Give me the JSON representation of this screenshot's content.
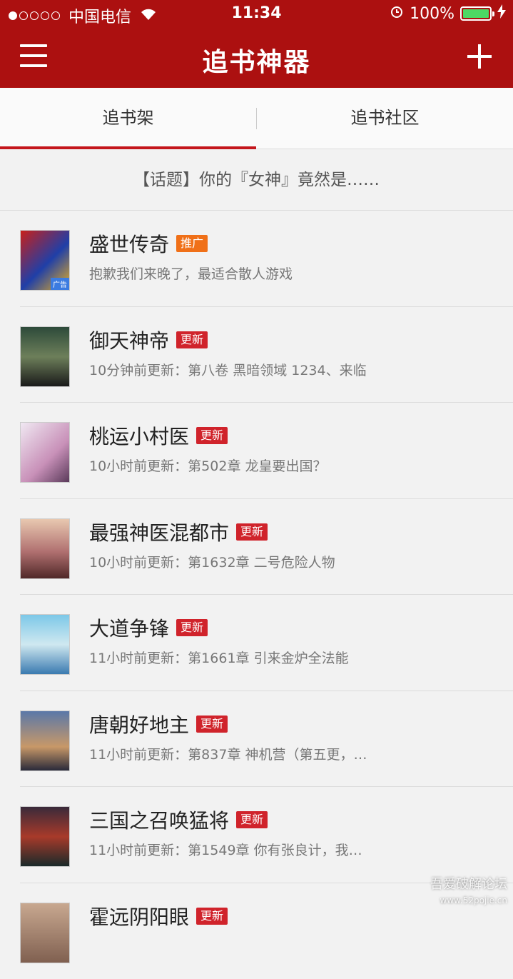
{
  "status_bar": {
    "carrier": "中国电信",
    "time": "11:34",
    "battery": "100%"
  },
  "header": {
    "title": "追书神器"
  },
  "tabs": [
    {
      "label": "追书架",
      "active": true
    },
    {
      "label": "追书社区",
      "active": false
    }
  ],
  "topic": {
    "text": "【话题】你的『女神』竟然是……"
  },
  "books": [
    {
      "title": "盛世传奇",
      "badge": "推广",
      "badge_type": "promo",
      "desc": "抱歉我们来晚了，最适合散人游戏",
      "ad_label": "广告"
    },
    {
      "title": "御天神帝",
      "badge": "更新",
      "badge_type": "update",
      "desc": "10分钟前更新：第八卷 黑暗领域 1234、来临"
    },
    {
      "title": "桃运小村医",
      "badge": "更新",
      "badge_type": "update",
      "desc": "10小时前更新：第502章 龙皇要出国？"
    },
    {
      "title": "最强神医混都市",
      "badge": "更新",
      "badge_type": "update",
      "desc": "10小时前更新：第1632章 二号危险人物"
    },
    {
      "title": "大道争锋",
      "badge": "更新",
      "badge_type": "update",
      "desc": "11小时前更新：第1661章 引来金炉全法能"
    },
    {
      "title": "唐朝好地主",
      "badge": "更新",
      "badge_type": "update",
      "desc": "11小时前更新：第837章 神机营（第五更，…"
    },
    {
      "title": "三国之召唤猛将",
      "badge": "更新",
      "badge_type": "update",
      "desc": "11小时前更新：第1549章 你有张良计，我…"
    },
    {
      "title": "霍远阴阳眼",
      "badge": "更新",
      "badge_type": "update",
      "desc": ""
    }
  ],
  "watermark": {
    "line1": "吾爱破解论坛",
    "line2": "www.52pojie.cn"
  },
  "colors": {
    "brand_red": "#ac1010",
    "badge_update": "#d0232b",
    "badge_promo": "#f07018"
  }
}
